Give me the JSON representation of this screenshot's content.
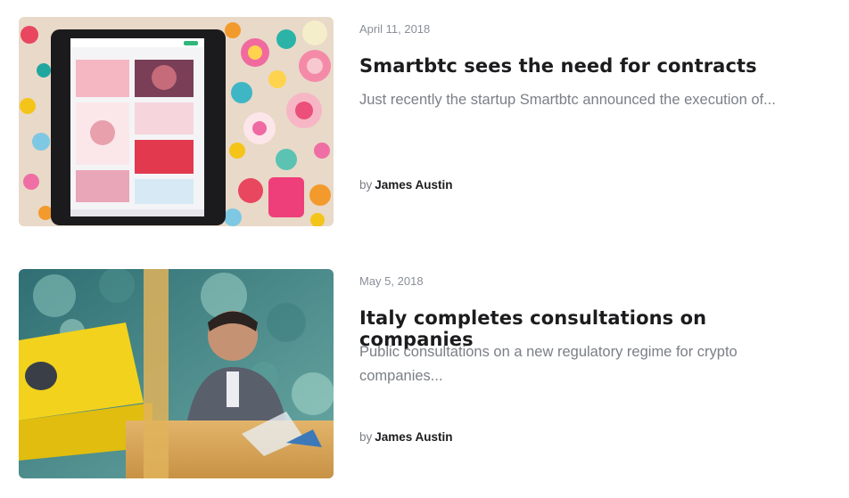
{
  "posts": [
    {
      "date": "April 11, 2018",
      "title": "Smartbtc sees the need for contracts",
      "excerpt": "Just recently the startup Smartbtc announced the execution of...",
      "by_label": "by",
      "author": "James Austin",
      "image_subject": "tablet-on-confetti"
    },
    {
      "date": "May 5, 2018",
      "title": "Italy completes consultations on companies",
      "excerpt": "Public consultations on a new regulatory regime for crypto companies...",
      "by_label": "by",
      "author": "James Austin",
      "image_subject": "office-people-yellow-sofa"
    }
  ],
  "colors": {
    "title": "#1c1c1e",
    "muted": "#7b7f86",
    "date": "#8a8f98"
  }
}
